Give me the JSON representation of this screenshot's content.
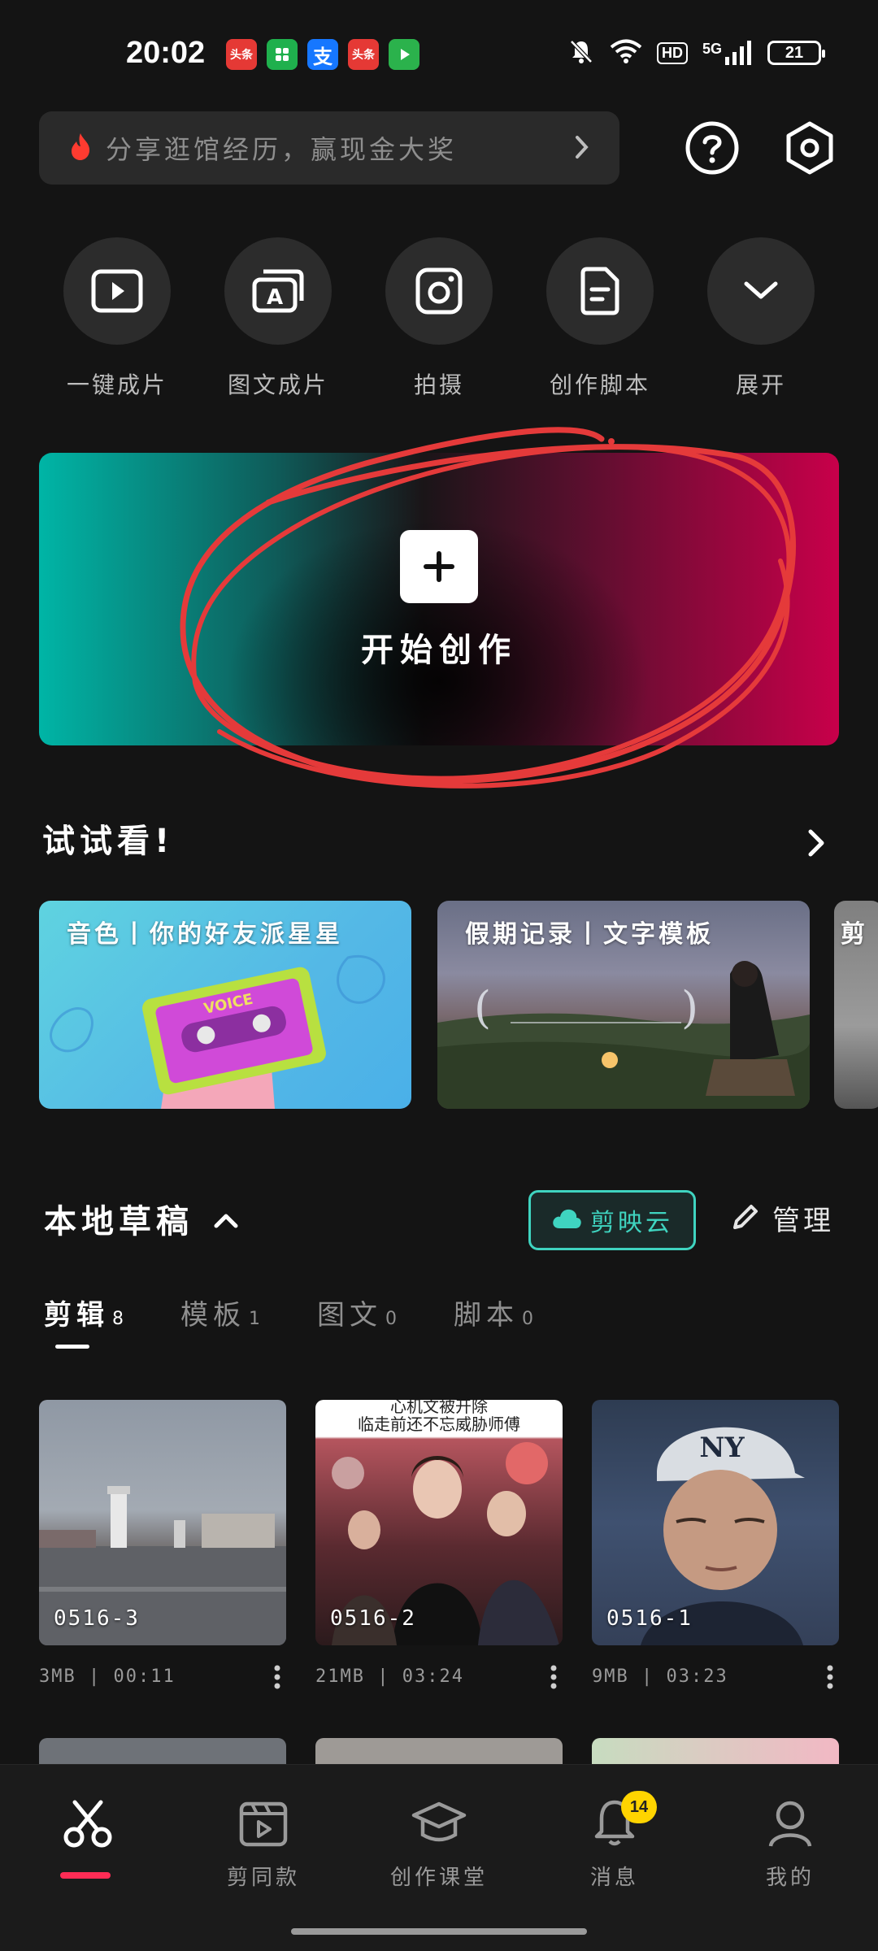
{
  "status_bar": {
    "time": "20:02",
    "notifications": [
      {
        "label": "头条",
        "icon": "toutiao-app-icon",
        "color": "#e53935"
      },
      {
        "label": "",
        "icon": "wechat-mini-icon",
        "color": "#1fb04d"
      },
      {
        "label": "支",
        "icon": "alipay-icon",
        "color": "#1677ff"
      },
      {
        "label": "头条",
        "icon": "toutiao-app-icon",
        "color": "#e53935"
      },
      {
        "label": "",
        "icon": "video-app-icon",
        "color": "#2bb24c"
      }
    ],
    "hd": "HD",
    "network": "5G",
    "battery": "21"
  },
  "search": {
    "text": "分享逛馆经历，赢现金大奖",
    "icon": "flame-icon"
  },
  "top_actions": {
    "help_icon": "help-icon",
    "settings_icon": "settings-icon"
  },
  "quick_actions": [
    {
      "label": "一键成片",
      "icon": "play-icon"
    },
    {
      "label": "图文成片",
      "icon": "text-image-icon"
    },
    {
      "label": "拍摄",
      "icon": "camera-icon"
    },
    {
      "label": "创作脚本",
      "icon": "script-icon"
    },
    {
      "label": "展开",
      "icon": "chevron-down-icon"
    }
  ],
  "hero": {
    "label": "开始创作"
  },
  "try_section": {
    "title": "试试看!",
    "cards": [
      {
        "title": "音色丨你的好友派星星"
      },
      {
        "title": "假期记录丨文字模板"
      },
      {
        "title": "剪"
      }
    ]
  },
  "drafts": {
    "title": "本地草稿",
    "cloud_label": "剪映云",
    "manage_label": "管理",
    "tabs": [
      {
        "label": "剪辑",
        "count": "8"
      },
      {
        "label": "模板",
        "count": "1"
      },
      {
        "label": "图文",
        "count": "0"
      },
      {
        "label": "脚本",
        "count": "0"
      }
    ],
    "items": [
      {
        "name": "0516-3",
        "meta": "3MB | 00:11"
      },
      {
        "name": "0516-2",
        "meta": "21MB | 03:24",
        "caption_top": "心机文被开除",
        "caption": "临走前还不忘威胁师傅"
      },
      {
        "name": "0516-1",
        "meta": "9MB | 03:23"
      }
    ]
  },
  "bottom_nav": {
    "items": [
      {
        "label": "",
        "icon": "scissors-icon"
      },
      {
        "label": "剪同款",
        "icon": "template-icon"
      },
      {
        "label": "创作课堂",
        "icon": "graduation-cap-icon"
      },
      {
        "label": "消息",
        "icon": "bell-icon",
        "badge": "14"
      },
      {
        "label": "我的",
        "icon": "profile-icon"
      }
    ]
  },
  "colors": {
    "accent_teal": "#3fd4c0",
    "accent_red": "#fe2c55",
    "scribble_red": "#e53a3a"
  }
}
